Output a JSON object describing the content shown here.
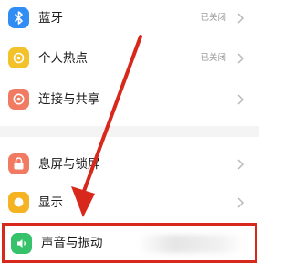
{
  "settings": {
    "items": [
      {
        "label": "蓝牙",
        "status": "已关闭",
        "icon": "bluetooth-icon",
        "icon_color": "#2f8df3"
      },
      {
        "label": "个人热点",
        "status": "已关闭",
        "icon": "hotspot-icon",
        "icon_color": "#f3c12a"
      },
      {
        "label": "连接与共享",
        "status": "",
        "icon": "share-icon",
        "icon_color": "#f07b62"
      },
      {
        "label": "息屏与锁屏",
        "status": "",
        "icon": "lock-icon",
        "icon_color": "#f07b62"
      },
      {
        "label": "显示",
        "status": "",
        "icon": "display-icon",
        "icon_color": "#f5b324"
      },
      {
        "label": "声音与振动",
        "status": "",
        "icon": "sound-icon",
        "icon_color": "#36c26a"
      }
    ]
  },
  "annotation": {
    "highlight_color": "#d8271b"
  }
}
